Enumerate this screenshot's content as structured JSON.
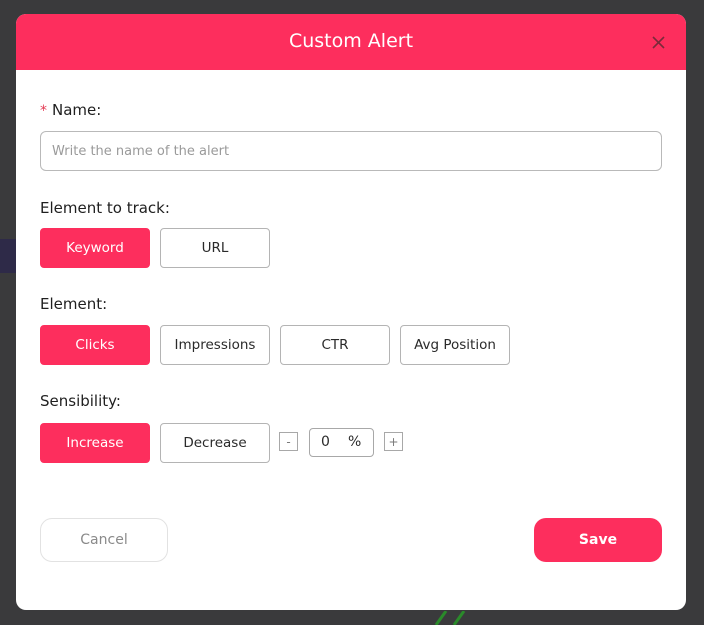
{
  "modal": {
    "title": "Custom Alert",
    "close_icon": "close-icon",
    "accent_color": "#fd2e5d"
  },
  "name_field": {
    "label": "Name:",
    "required_marker": "*",
    "placeholder": "Write the name of the alert",
    "value": ""
  },
  "element_to_track": {
    "label": "Element to track:",
    "options": [
      {
        "label": "Keyword",
        "selected": true
      },
      {
        "label": "URL",
        "selected": false
      }
    ]
  },
  "element": {
    "label": "Element:",
    "options": [
      {
        "label": "Clicks",
        "selected": true
      },
      {
        "label": "Impressions",
        "selected": false
      },
      {
        "label": "CTR",
        "selected": false
      },
      {
        "label": "Avg Position",
        "selected": false
      }
    ]
  },
  "sensibility": {
    "label": "Sensibility:",
    "options": [
      {
        "label": "Increase",
        "selected": true
      },
      {
        "label": "Decrease",
        "selected": false
      }
    ],
    "decrement_label": "-",
    "increment_label": "+",
    "value": "0",
    "unit": "%"
  },
  "footer": {
    "cancel_label": "Cancel",
    "save_label": "Save"
  }
}
